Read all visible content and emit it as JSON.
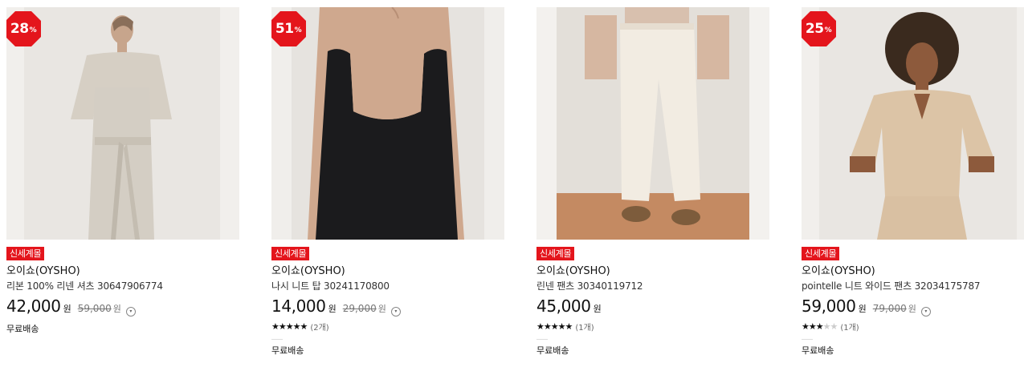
{
  "products": [
    {
      "discount": "28",
      "discount_unit": "%",
      "store": "신세계몰",
      "brand": "오이쇼(OYSHO)",
      "name": "리본 100% 리넨 셔츠 30647906774",
      "price": "42,000",
      "currency": "원",
      "original_price": "59,000",
      "original_currency": "원",
      "rating_stars": "",
      "rating_count": "",
      "shipping": "무료배송"
    },
    {
      "discount": "51",
      "discount_unit": "%",
      "store": "신세계몰",
      "brand": "오이쇼(OYSHO)",
      "name": "나시 니트 탑 30241170800",
      "price": "14,000",
      "currency": "원",
      "original_price": "29,000",
      "original_currency": "원",
      "rating_stars": "★★★★★",
      "rating_count": "(2개)",
      "shipping": "무료배송"
    },
    {
      "discount": "",
      "discount_unit": "",
      "store": "신세계몰",
      "brand": "오이쇼(OYSHO)",
      "name": "린넨 팬츠 30340119712",
      "price": "45,000",
      "currency": "원",
      "original_price": "",
      "original_currency": "",
      "rating_stars": "★★★★★",
      "rating_count": "(1개)",
      "shipping": "무료배송"
    },
    {
      "discount": "25",
      "discount_unit": "%",
      "store": "신세계몰",
      "brand": "오이쇼(OYSHO)",
      "name": "pointelle 니트 와이드 팬츠 32034175787",
      "price": "59,000",
      "currency": "원",
      "original_price": "79,000",
      "original_currency": "원",
      "rating_stars_on": "★★★",
      "rating_stars_off": "★★",
      "rating_count": "(1개)",
      "shipping": "무료배송"
    }
  ],
  "colors": {
    "badge_red": "#e4151c",
    "tag_red": "#e4151c"
  }
}
